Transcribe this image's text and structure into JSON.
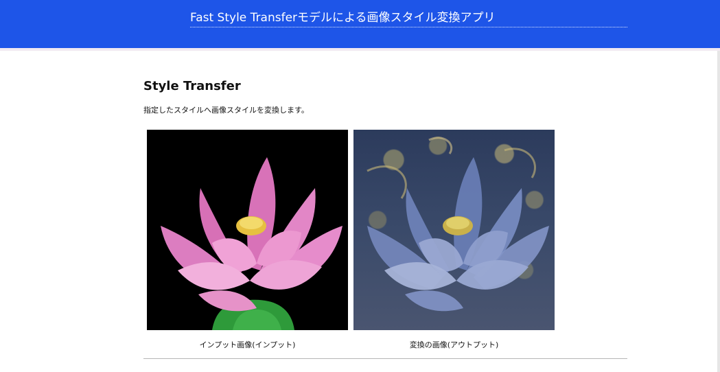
{
  "header": {
    "title": "Fast Style Transferモデルによる画像スタイル変換アプリ",
    "background_color": "#1e55e8"
  },
  "main": {
    "section_title": "Style Transfer",
    "description": "指定したスタイルへ画像スタイルを変換します。"
  },
  "images": {
    "input": {
      "caption": "インプット画像(インプット)",
      "subject": "pink lotus flower on black background"
    },
    "output": {
      "caption": "変換の画像(アウトプット)",
      "subject": "lotus flower styled in Starry Night painting style"
    }
  },
  "colors": {
    "accent": "#1e55e8",
    "lotus_pink": "#e07ac0",
    "lotus_center": "#e6c040",
    "stem_green": "#2e9a3a",
    "styled_blue": "#5a6fa8"
  }
}
